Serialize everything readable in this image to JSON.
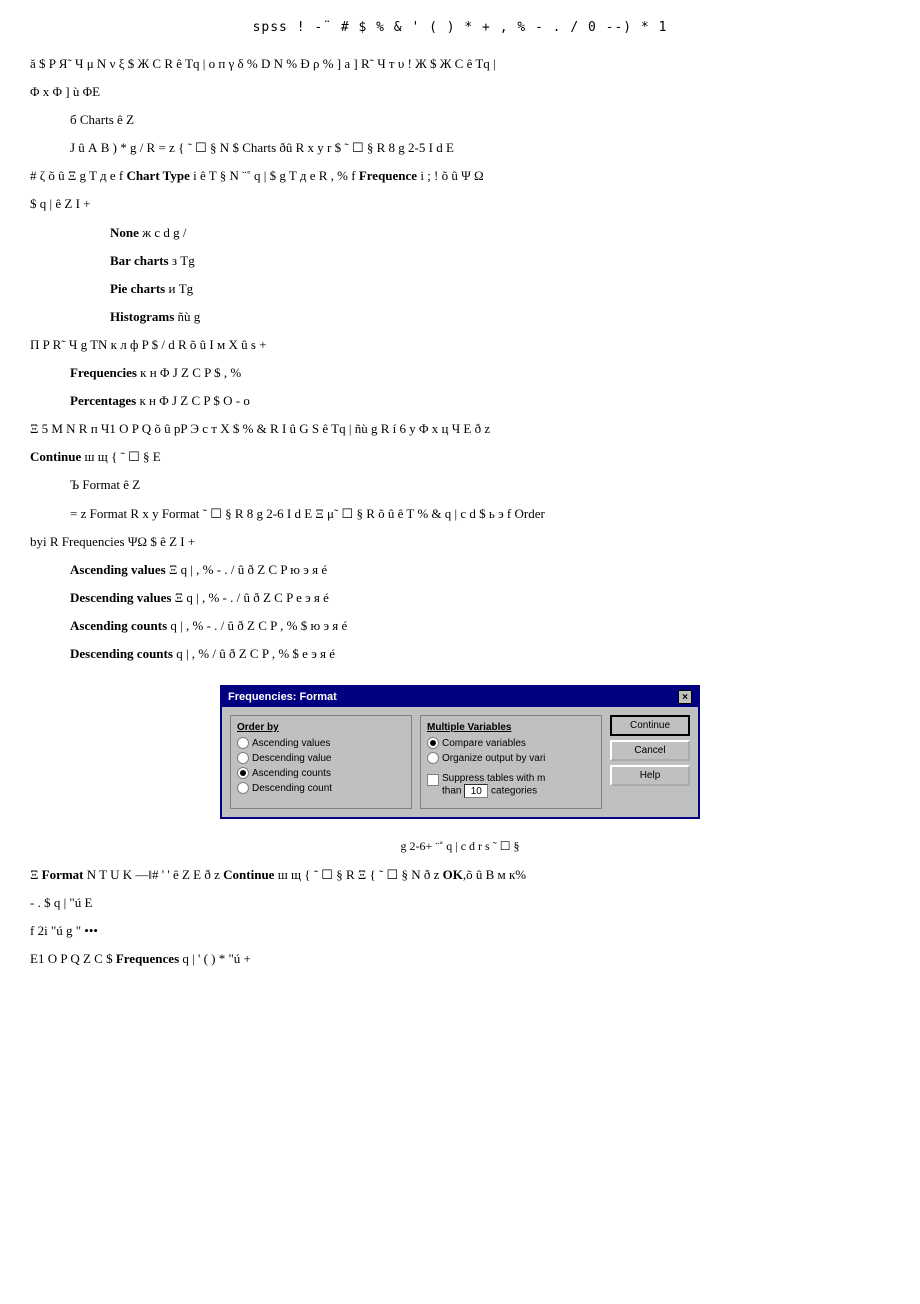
{
  "header": {
    "title": "spss   !  -¨ # $ % & ' ( ) * + , % - . / 0     --) * 1"
  },
  "lines": [
    {
      "id": "line1",
      "text": "ă $ P Я˜ Ч μ N ν ξ $ Ж С R ê Tq |  о п γ δ % D N % Đ ρ % ] а ] R˜ Ч т υ ! Ж $ Ж С ê Tq |"
    },
    {
      "id": "line2",
      "text": "Φ х Φ ] ù ΦE"
    },
    {
      "id": "line3_indent",
      "text": "б Charts ê Z"
    },
    {
      "id": "line4_indent",
      "text": "J û А В ) * g / R = z { ˜ ☐ § N $       Charts  ðû R х у  r $ ˜ ☐ § R 8 g      2-5 I d E"
    },
    {
      "id": "line5",
      "prefix": "# ζ õ û  Ξ g T д е f    ",
      "term1": "Chart Type",
      "middle": " i ê T § N ¨˚ q | $ g T д е R , % f       ",
      "term2": "Frequence",
      "suffix": " i ;  ! õ û Ψ Ω"
    },
    {
      "id": "line6",
      "text": "$ q | ê Z I +"
    },
    {
      "id": "none_line",
      "label": "None",
      "suffix": " ж с d g /"
    },
    {
      "id": "bar_line",
      "label": "Bar charts",
      "suffix": " з Тg"
    },
    {
      "id": "pie_line",
      "label": "Pie charts",
      "suffix": " и Тg"
    },
    {
      "id": "hist_line",
      "label": "Histograms",
      "suffix": " ñù g"
    }
  ],
  "section2": {
    "prefix": "П P R˜ Ч g TN к л ф P $ / d R õ û I м X û s +"
  },
  "freq_items": [
    {
      "label": "Frequencies",
      "suffix": " к н Φ J Z C P $ , %"
    },
    {
      "label": "Percentages",
      "suffix": " к н Φ J Z C P $ О - о"
    }
  ],
  "section3": {
    "text": "Ξ 5 М N R п Ч1 О P Q õ û  рP Э с т X $ % & R I û G S ê Tq |  ñù g R í 6 у Φ х ц Ч E ð z"
  },
  "continue_line": {
    "label": "Continue",
    "suffix": " ш щ { ˜ ☐ § E"
  },
  "format_section": {
    "indent_label": "Ъ Format ê Z",
    "line1": "= z  Format   R х у  Format  ˜ ☐ § R 8 g  2-6 I d E Ξ μ˜ ☐ § R  õ û ê T % & q | с d $ ь э      f  Order"
  },
  "orderby_line": {
    "text": "byi R  Frequencies ΨΩ $ ê Z I +"
  },
  "order_options": [
    {
      "label": "Ascending values",
      "suffix": " Ξ q | , % - . / û ð Z C P ю э я é"
    },
    {
      "label": "Descending values",
      "suffix": " Ξ q | , % - . / û ð Z C P е э я é"
    },
    {
      "label": "Ascending counts",
      "suffix": " q | , % - . / û ð Z C P , % $ ю э я é"
    },
    {
      "label": "Descending counts",
      "suffix": " q | , % / û ð Z C P , % $ е э я é"
    }
  ],
  "dialog": {
    "title": "Frequencies: Format",
    "close_btn": "×",
    "order_by_section": {
      "title": "Order by",
      "options": [
        {
          "label": "Ascending values",
          "selected": false
        },
        {
          "label": "Descending value",
          "selected": false
        },
        {
          "label": "Ascending counts",
          "selected": true
        },
        {
          "label": "Descending count",
          "selected": false
        }
      ]
    },
    "multiple_vars_section": {
      "title": "Multiple Variables",
      "options": [
        {
          "label": "Compare variables",
          "selected": true
        },
        {
          "label": "Organize output by vari",
          "selected": false
        }
      ],
      "checkbox_label": "Suppress tables with m",
      "checkbox_suffix": "than",
      "input_value": "10",
      "input_suffix": "categories"
    },
    "buttons": [
      {
        "label": "Continue",
        "default": true
      },
      {
        "label": "Cancel",
        "default": false
      },
      {
        "label": "Help",
        "default": false
      }
    ]
  },
  "figure_caption": {
    "text": "g  2-6+  ¨˚ q | с d r s ˜ ☐ §"
  },
  "bottom_lines": [
    {
      "id": "bottom1",
      "parts": [
        {
          "bold": false,
          "text": "Ξ "
        },
        {
          "bold": true,
          "text": "Format"
        },
        {
          "bold": false,
          "text": " N T U K —‖#  ' ' ê Z E ð z     "
        },
        {
          "bold": true,
          "text": "Continue"
        },
        {
          "bold": false,
          "text": " ш щ { ˜ ☐ § R Ξ { ˜ ☐ § N ð z     "
        },
        {
          "bold": true,
          "text": "OK"
        },
        {
          "bold": false,
          "text": ",õ û B м к%"
        }
      ]
    },
    {
      "id": "bottom2",
      "text": "- . $ q |  \"ú E"
    },
    {
      "id": "bottom3",
      "text": "f  2i  \"ú g \" •••"
    },
    {
      "id": "bottom4",
      "parts": [
        {
          "bold": false,
          "text": "E1 О P Q Z C $   "
        },
        {
          "bold": true,
          "text": "Frequences"
        },
        {
          "bold": false,
          "text": " q | ' ( ) *  \"ú  +"
        }
      ]
    }
  ]
}
